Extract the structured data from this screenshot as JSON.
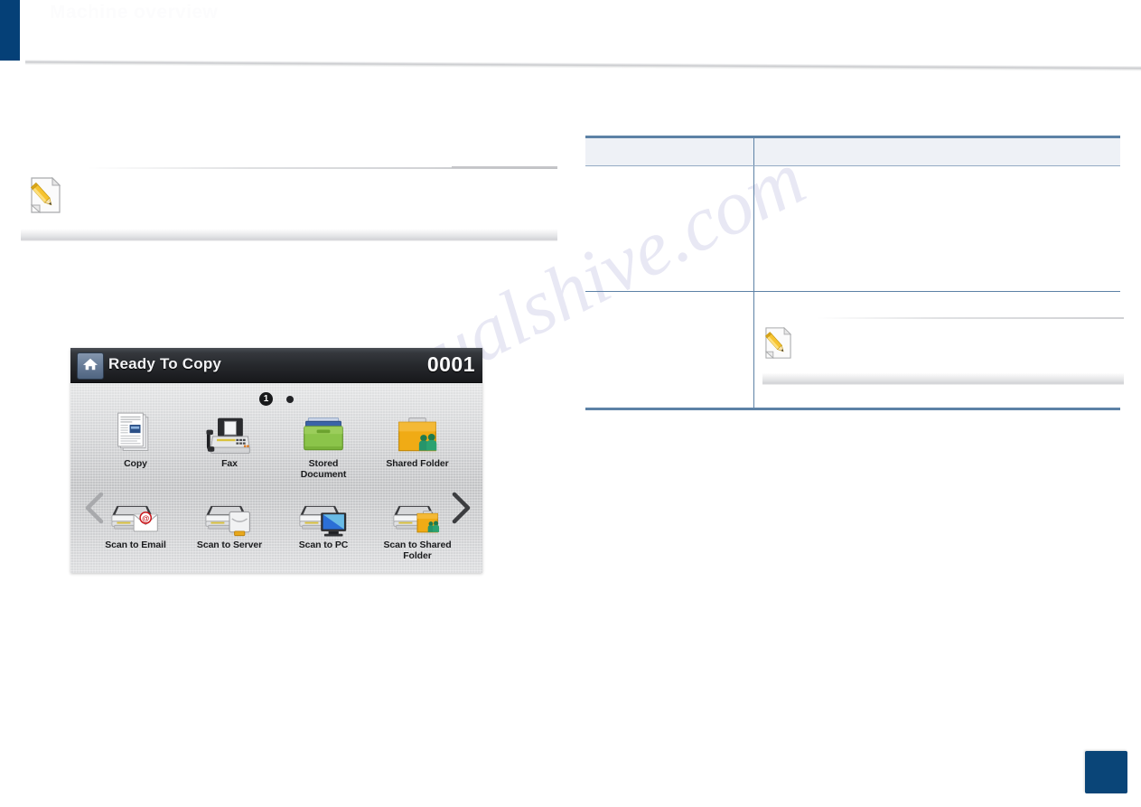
{
  "header": {
    "title": "Machine overview",
    "subtitle": "",
    "accent_color": "#054077"
  },
  "note": {
    "icon": "note-pencil-icon",
    "text": ""
  },
  "control_panel": {
    "title": "Ready To Copy",
    "home_icon": "home-icon",
    "counter": "0001",
    "prev_icon": "chevron-left-icon",
    "next_icon": "chevron-right-icon",
    "page_indicator": {
      "active_label": "1",
      "pages": 2
    },
    "apps": [
      {
        "label": "Copy",
        "icon": "copy-documents-icon"
      },
      {
        "label": "Fax",
        "icon": "fax-machine-icon"
      },
      {
        "label": "Stored\nDocument",
        "icon": "stored-document-box-icon"
      },
      {
        "label": "Shared Folder",
        "icon": "shared-folder-icon"
      },
      {
        "label": "Scan to Email",
        "icon": "scan-to-email-icon"
      },
      {
        "label": "Scan to Server",
        "icon": "scan-to-server-icon"
      },
      {
        "label": "Scan to PC",
        "icon": "scan-to-pc-icon"
      },
      {
        "label": "Scan to Shared\nFolder",
        "icon": "scan-to-shared-folder-icon"
      }
    ],
    "colors": {
      "titlebar": "#26282c",
      "screen": "#cfd0d2",
      "home_button": "#6a7e99"
    }
  },
  "table": {
    "columns": [
      "",
      ""
    ],
    "rows": [
      {
        "key": "",
        "value": ""
      },
      {
        "key": "",
        "value": "",
        "note": {
          "icon": "note-pencil-icon",
          "text": ""
        }
      }
    ],
    "border_color": "#5d82a6",
    "header_fill": "#eef1f6"
  },
  "page_tab": {
    "number": "",
    "color": "#0a4578"
  },
  "watermark": {
    "line1": "manualshive.com"
  }
}
